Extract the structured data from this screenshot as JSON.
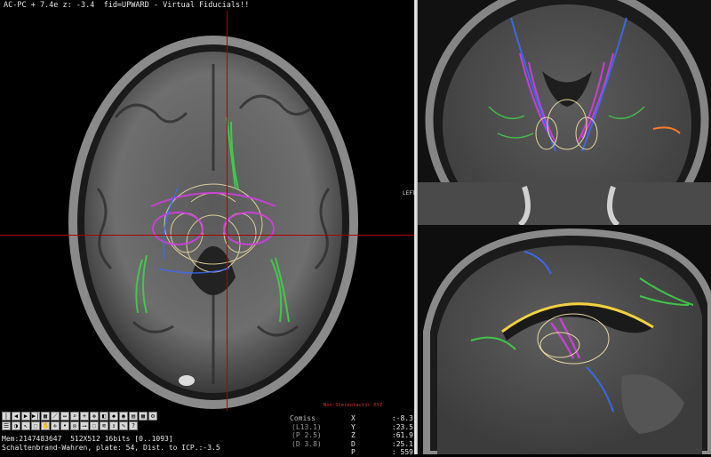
{
  "header": {
    "title": "AC-PC + 7.4e z: -3.4  fid=UPWARD - Virtual Fiducials!!"
  },
  "axial_view": {
    "side_label": "LEFT",
    "overlay_mark": "Non-Stereotactic XYZ"
  },
  "toolbar": {
    "icons": [
      "back-start-icon",
      "back-icon",
      "forward-icon",
      "forward-end-icon",
      "save-icon",
      "measure-icon",
      "ruler-icon",
      "zoom-icon",
      "zoom-in-icon",
      "pan-icon",
      "window-icon",
      "color-icon",
      "camera-icon",
      "print-icon",
      "grid-icon",
      "settings-icon",
      "layers-icon",
      "window-level-icon",
      "pointer-icon",
      "select-icon",
      "hand-icon",
      "crosshair-icon",
      "fiducial-icon",
      "target-icon",
      "trajectory-icon",
      "contour-icon",
      "fiber-icon",
      "ruler2-icon",
      "annotation-icon",
      "help-icon"
    ]
  },
  "status": {
    "line1": "Mem:2147483647  512X512 16bits [0..1093]",
    "line2": "Schaltenbrand-Wahren, plate: 54, Dist. to ICP.:-3.5"
  },
  "comiss": {
    "label": "Comiss",
    "l": "(L13.1)",
    "p": "(P 2.5)",
    "d": "(D 3.8)"
  },
  "coords": [
    {
      "key": "X",
      "value": ":-8.3"
    },
    {
      "key": "Y",
      "value": ":23.5"
    },
    {
      "key": "Z",
      "value": ":61.9"
    },
    {
      "key": "D",
      "value": ":25.1"
    },
    {
      "key": "P",
      "value": ":   559"
    }
  ],
  "colors": {
    "crosshair": "#b40000",
    "mark": "#e53030",
    "fiber_green": "#3fd14a",
    "fiber_magenta": "#d23ee0",
    "fiber_blue": "#3a6cff",
    "atlas_outline": "#e8d7a0"
  }
}
